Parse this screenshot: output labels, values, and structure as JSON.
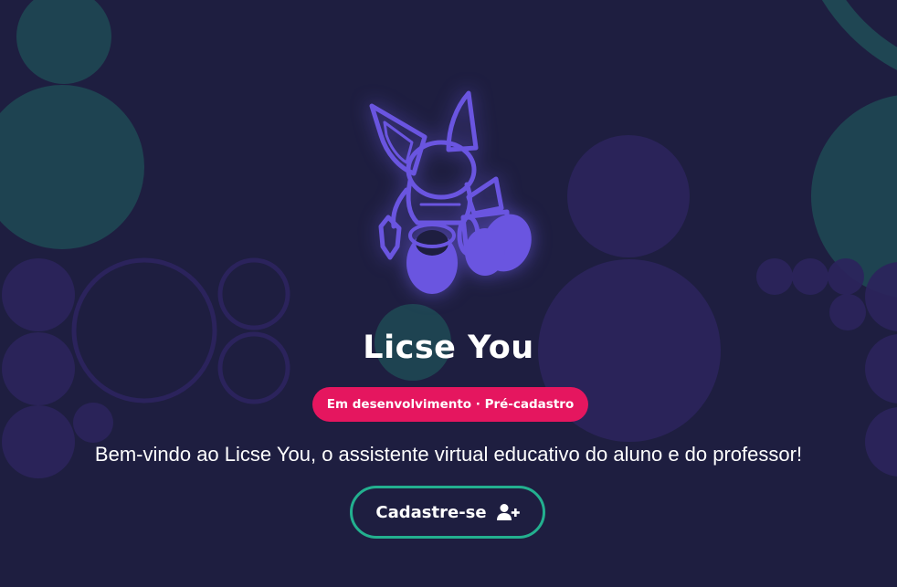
{
  "app": {
    "title": "Licse You",
    "badge": "Em desenvolvimento · Pré-cadastro",
    "subtitle": "Bem-vindo ao Licse You, o assistente virtual educativo do aluno e do professor!"
  },
  "cta": {
    "label": "Cadastre-se",
    "icon": "user-plus-icon"
  },
  "mascot": {
    "icon": "rabbit-robot-mascot"
  },
  "colors": {
    "background": "#1e1e40",
    "accent_purple": "#6a55e0",
    "badge_pink": "#e5165f",
    "button_border_teal": "#23b08f",
    "text": "#ffffff"
  }
}
